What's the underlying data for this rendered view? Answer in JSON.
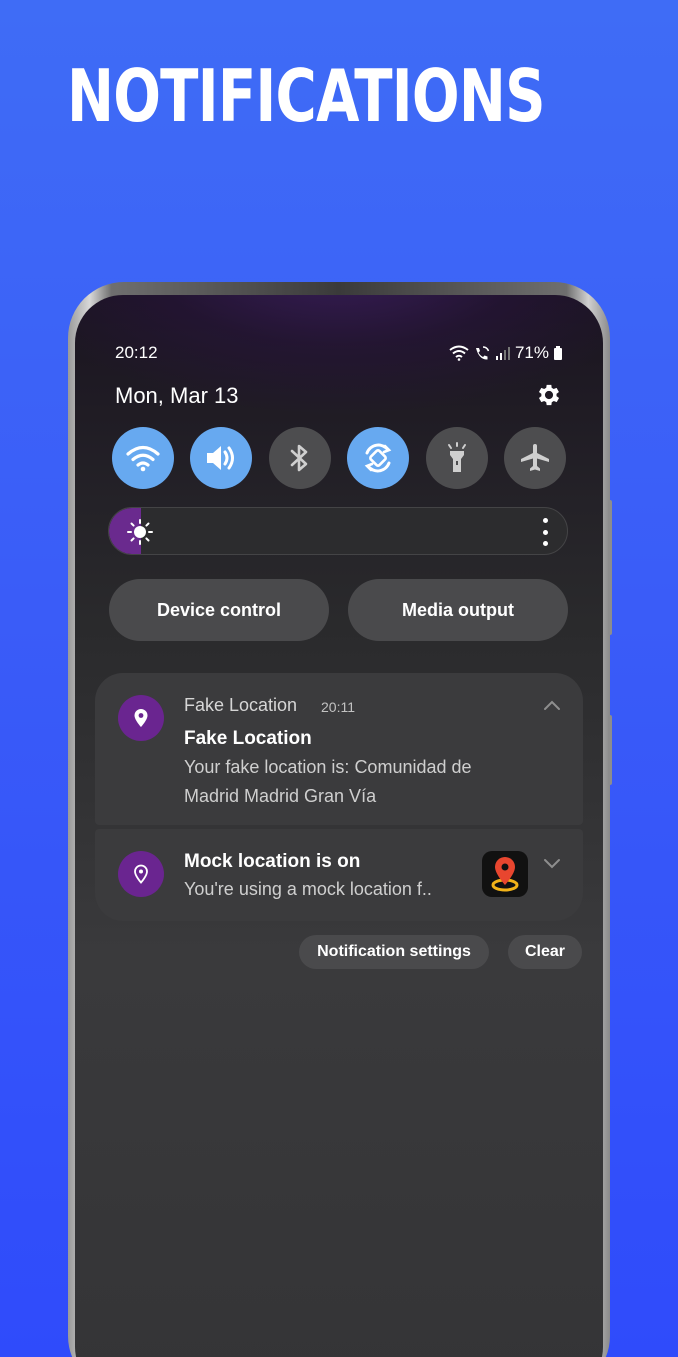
{
  "headline": "NOTIFICATIONS",
  "status_bar": {
    "time": "20:12",
    "battery": "71%"
  },
  "panel": {
    "date": "Mon, Mar 13"
  },
  "quick_settings": [
    {
      "name": "wifi",
      "on": true
    },
    {
      "name": "sound",
      "on": true
    },
    {
      "name": "bluetooth",
      "on": false
    },
    {
      "name": "auto-rotate",
      "on": true
    },
    {
      "name": "flashlight",
      "on": false
    },
    {
      "name": "airplane-mode",
      "on": false
    }
  ],
  "brightness": {
    "level": 0.07
  },
  "buttons": {
    "device_control": "Device control",
    "media_output": "Media output"
  },
  "notifications": [
    {
      "app_name": "Fake Location",
      "time": "20:11",
      "title": "Fake Location",
      "body_line1": "Your fake location is:  Comunidad de",
      "body_line2": "Madrid Madrid Gran Vía"
    },
    {
      "title": "Mock location is on",
      "body": "You're using a mock location f.."
    }
  ],
  "actions": {
    "notification_settings": "Notification settings",
    "clear": "Clear"
  },
  "colors": {
    "accent_blue": "#67a9f0",
    "app_purple": "#6a2590",
    "background": "#3a5cf8"
  }
}
